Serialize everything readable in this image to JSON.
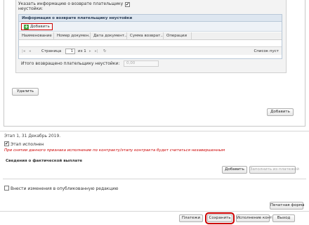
{
  "refund_section": {
    "indicate_label_line1": "Указать информацию о возврате плательщику",
    "indicate_label_line2": "неустойки:",
    "indicate_checked": "✔",
    "panel_title": "Информация о возврате плательщику неустойки",
    "add_label": "Добавить",
    "columns": [
      "Наименование ...",
      "Номер докумен...",
      "Дата документ...",
      "Сумма возврат...",
      "Операции"
    ],
    "pager": {
      "page_label": "Страница",
      "page_value": "1",
      "of_label": "из 1",
      "empty_label": "Список пуст"
    },
    "total_label": "Итого возвращено плательщику неустойки:",
    "total_value": "0,00"
  },
  "delete_label": "Удалить",
  "add_bottom_label": "Добавить",
  "stage": {
    "title": "Этап 1, 31 Декабрь 2019.",
    "done_label": "Этап исполнен",
    "done_checked": "✔",
    "warning": "При снятии данного признака исполнение по контракту/этапу контракта будет считаться незавершенным",
    "payment_info_title": "Сведения о фактической выплате",
    "add_label": "Добавить",
    "fill_from_label": "Заполнить из платежей"
  },
  "publish_label": "Внести изменения в опубликованную редакцию",
  "print_label": "Печатная форма",
  "footer": {
    "payments": "Платежи",
    "save": "Сохранить",
    "execution": "Исполнение контракта",
    "exit": "Выход"
  },
  "colors": {
    "highlight": "#cc0000",
    "add_icon": "#3fa33f",
    "panel_header": "#dde6f0"
  }
}
